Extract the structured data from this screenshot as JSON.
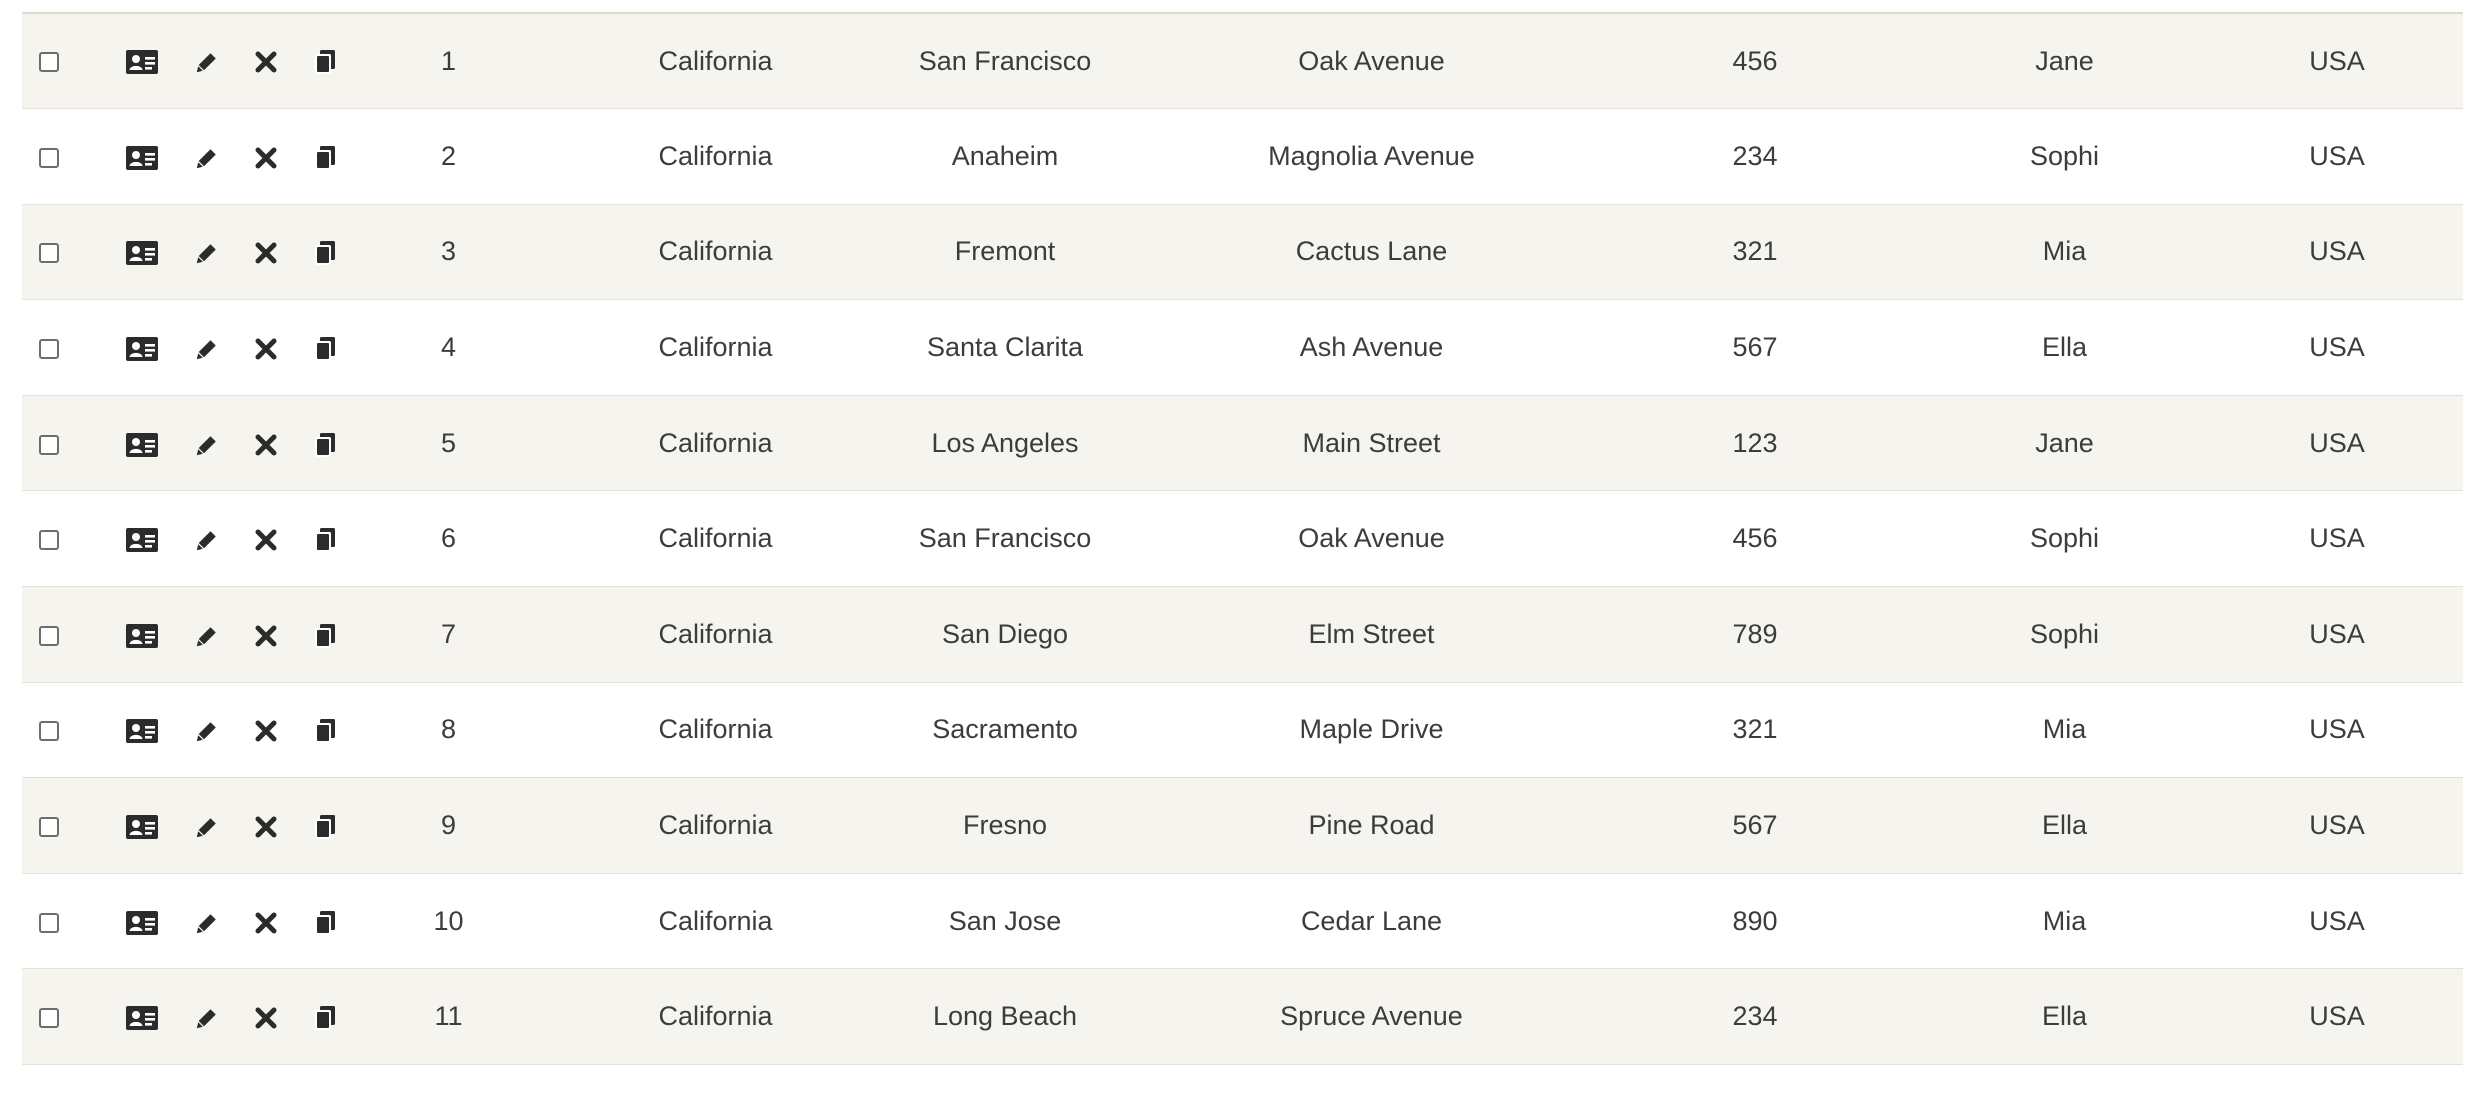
{
  "rows": [
    {
      "id": "1",
      "state": "California",
      "city": "San Francisco",
      "street": "Oak Avenue",
      "number": "456",
      "name": "Jane",
      "country": "USA"
    },
    {
      "id": "2",
      "state": "California",
      "city": "Anaheim",
      "street": "Magnolia Avenue",
      "number": "234",
      "name": "Sophi",
      "country": "USA"
    },
    {
      "id": "3",
      "state": "California",
      "city": "Fremont",
      "street": "Cactus Lane",
      "number": "321",
      "name": "Mia",
      "country": "USA"
    },
    {
      "id": "4",
      "state": "California",
      "city": "Santa Clarita",
      "street": "Ash Avenue",
      "number": "567",
      "name": "Ella",
      "country": "USA"
    },
    {
      "id": "5",
      "state": "California",
      "city": "Los Angeles",
      "street": "Main Street",
      "number": "123",
      "name": "Jane",
      "country": "USA"
    },
    {
      "id": "6",
      "state": "California",
      "city": "San Francisco",
      "street": "Oak Avenue",
      "number": "456",
      "name": "Sophi",
      "country": "USA"
    },
    {
      "id": "7",
      "state": "California",
      "city": "San Diego",
      "street": "Elm Street",
      "number": "789",
      "name": "Sophi",
      "country": "USA"
    },
    {
      "id": "8",
      "state": "California",
      "city": "Sacramento",
      "street": "Maple Drive",
      "number": "321",
      "name": "Mia",
      "country": "USA"
    },
    {
      "id": "9",
      "state": "California",
      "city": "Fresno",
      "street": "Pine Road",
      "number": "567",
      "name": "Ella",
      "country": "USA"
    },
    {
      "id": "10",
      "state": "California",
      "city": "San Jose",
      "street": "Cedar Lane",
      "number": "890",
      "name": "Mia",
      "country": "USA"
    },
    {
      "id": "11",
      "state": "California",
      "city": "Long Beach",
      "street": "Spruce Avenue",
      "number": "234",
      "name": "Ella",
      "country": "USA"
    }
  ],
  "row_icons": [
    "id-card-icon",
    "pencil-icon",
    "close-icon",
    "copy-icon"
  ],
  "colors": {
    "stripe": "#f6f4ef",
    "border": "#e4e1da",
    "text": "#3c3c3c",
    "icon": "#2b2b2b"
  }
}
